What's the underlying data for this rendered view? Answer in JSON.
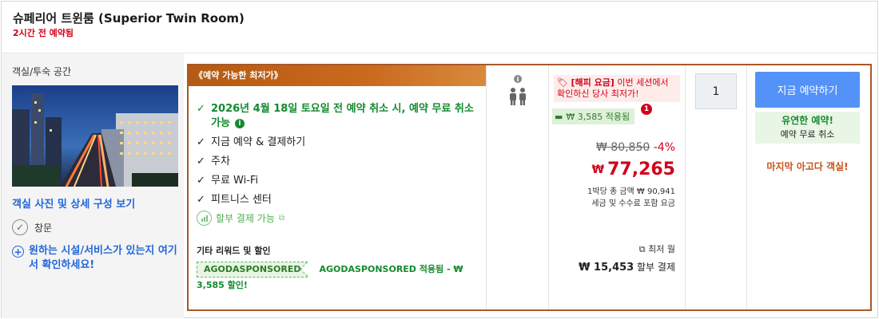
{
  "header": {
    "room_title": "슈페리어 트윈룸 (Superior Twin Room)",
    "booked_note": "2시간 전 예약됨"
  },
  "room_panel": {
    "space_label": "객실/투숙 공간",
    "photo_link": "객실 사진 및 상세 구성 보기",
    "amenity": "창문",
    "facility_link": "원하는 시설/서비스가 있는지 여기서 확인하세요!"
  },
  "offer": {
    "ribbon": "《예약 가능한 최저가》",
    "benefits": [
      "2026년 4월 18일 토요일 전 예약 취소 시, 예약 무료 취소 가능",
      "지금 예약 & 결제하기",
      "주차",
      "무료 Wi-Fi",
      "피트니스 센터"
    ],
    "check_mark": "✓",
    "installment": "할부 결제 가능",
    "other_title": "기타 리워드 및 할인",
    "promo_code": "AGODASPONSORED",
    "promo_text": "AGODASPONSORED 적용됨 - ₩ 3,585 할인!"
  },
  "pricing": {
    "happy_label": "[해피 요금]",
    "happy_text": " 이번 세션에서 확인하신 당사 최저가!",
    "coupon": "₩ 3,585 적용됨",
    "coupon_count": "1",
    "original_price": "₩ 80,850",
    "discount": "-4%",
    "currency": "₩",
    "final_price": "77,265",
    "per_night_line1": "1박당 총 금액 ₩ 90,941",
    "per_night_line2": "세금 및 수수료 포함 요금",
    "monthly_label": "최저 월",
    "monthly_amount": "₩ 15,453",
    "monthly_suffix": " 할부 결제"
  },
  "booking": {
    "quantity": "1",
    "book_button": "지금 예약하기",
    "flex_title": "유연한 예약!",
    "flex_sub": "예약 무료 취소",
    "last_room": "마지막 아고다 객실!"
  },
  "colors": {
    "accent_blue": "#5392f9",
    "price_red": "#d0021b",
    "green": "#138a2f",
    "ribbon_brown": "#b45a12"
  }
}
